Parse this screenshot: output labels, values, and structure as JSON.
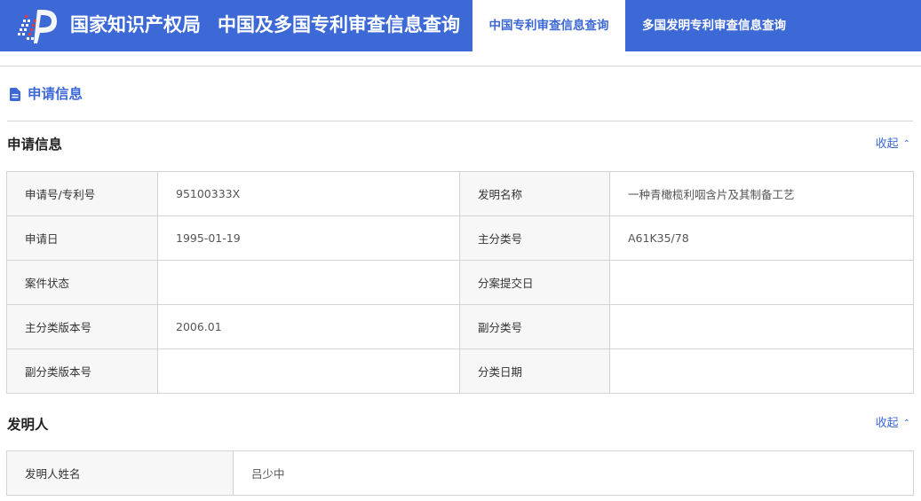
{
  "header": {
    "org_name": "国家知识产权局",
    "system_name": "中国及多国专利审查信息查询",
    "tabs": [
      {
        "label": "中国专利审查信息查询",
        "active": true
      },
      {
        "label": "多国发明专利审查信息查询",
        "active": false
      }
    ],
    "bar_color": "#3d69d6"
  },
  "page": {
    "title": "申请信息",
    "title_icon": "document-icon"
  },
  "application_section": {
    "title": "申请信息",
    "collapse_label": "收起",
    "collapse_icon": "chevron-up-icon",
    "rows": [
      {
        "label1": "申请号/专利号",
        "value1": "95100333X",
        "label2": "发明名称",
        "value2": "一种青橄榄利咽含片及其制备工艺"
      },
      {
        "label1": "申请日",
        "value1": "1995-01-19",
        "label2": "主分类号",
        "value2": "A61K35/78"
      },
      {
        "label1": "案件状态",
        "value1": "",
        "label2": "分案提交日",
        "value2": ""
      },
      {
        "label1": "主分类版本号",
        "value1": "2006.01",
        "label2": "副分类号",
        "value2": ""
      },
      {
        "label1": "副分类版本号",
        "value1": "",
        "label2": "分类日期",
        "value2": ""
      }
    ]
  },
  "inventor_section": {
    "title": "发明人",
    "collapse_label": "收起",
    "collapse_icon": "chevron-up-icon",
    "rows": [
      {
        "label": "发明人姓名",
        "value": "吕少中"
      }
    ]
  }
}
